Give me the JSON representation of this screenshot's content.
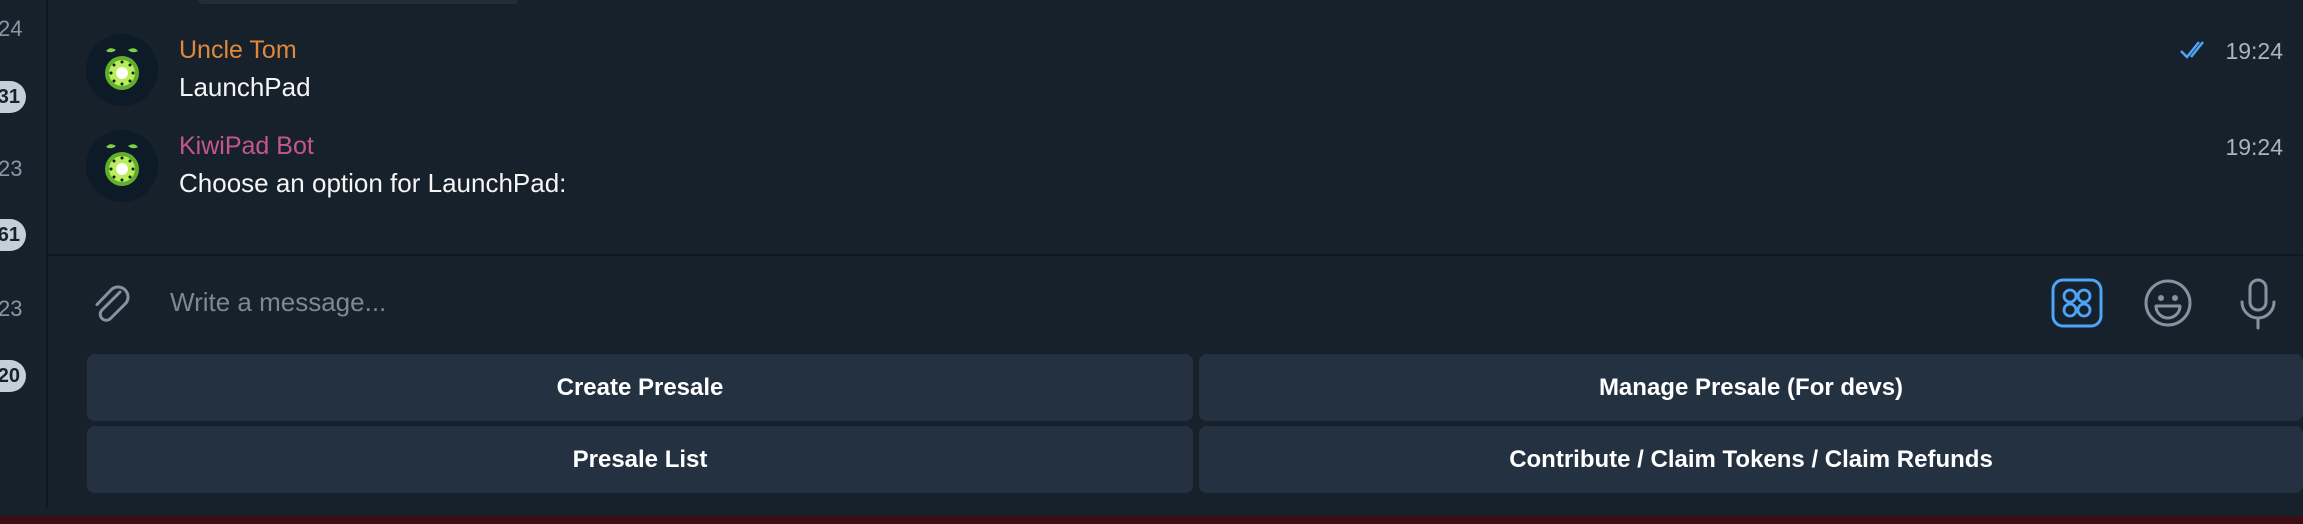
{
  "chat_list": {
    "times": [
      "24",
      "23",
      "23"
    ],
    "badges": [
      "31",
      "61",
      "20"
    ]
  },
  "messages": [
    {
      "sender": "Uncle Tom",
      "sender_color": "#e0883b",
      "text": "LaunchPad",
      "time": "19:24",
      "read": true
    },
    {
      "sender": "KiwiPad Bot",
      "sender_color": "#c6568e",
      "text": "Choose an option for LaunchPad:",
      "time": "19:24",
      "read": false
    }
  ],
  "composer": {
    "placeholder": "Write a message...",
    "attach_icon": "paperclip-icon",
    "commands_icon": "bot-commands-icon",
    "emoji_icon": "emoji-icon",
    "mic_icon": "microphone-icon"
  },
  "keyboard": {
    "rows": [
      [
        "Create Presale",
        "Manage Presale (For devs)"
      ],
      [
        "Presale List",
        "Contribute / Claim Tokens / Claim Refunds"
      ]
    ]
  },
  "colors": {
    "background": "#17212b",
    "button": "#243140",
    "accent": "#4ea4f6"
  }
}
